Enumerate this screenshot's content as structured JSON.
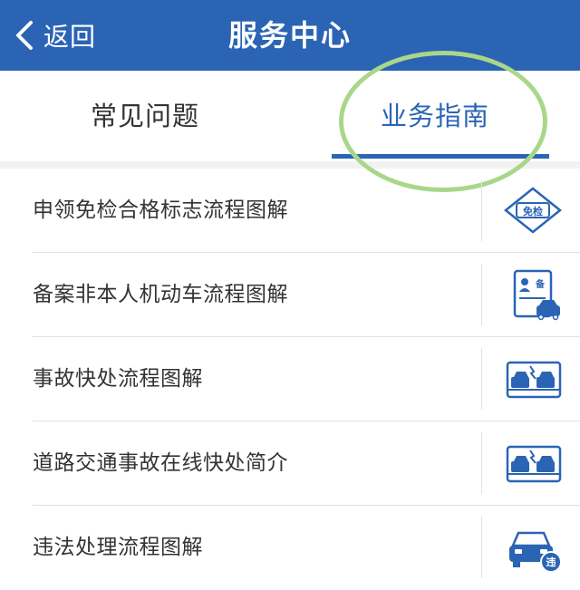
{
  "header": {
    "back_label": "返回",
    "title": "服务中心"
  },
  "tabs": [
    {
      "label": "常见问题",
      "active": false
    },
    {
      "label": "业务指南",
      "active": true
    }
  ],
  "colors": {
    "brand": "#2b64b4",
    "highlight": "#a9d78a"
  },
  "items": [
    {
      "label": "申领免检合格标志流程图解",
      "icon": "exemption-badge-icon",
      "icon_text": "免检"
    },
    {
      "label": "备案非本人机动车流程图解",
      "icon": "vehicle-registration-card-icon",
      "icon_text": "备"
    },
    {
      "label": "事故快处流程图解",
      "icon": "car-collision-icon"
    },
    {
      "label": "道路交通事故在线快处简介",
      "icon": "car-collision-icon"
    },
    {
      "label": "违法处理流程图解",
      "icon": "car-violation-icon",
      "icon_text": "违"
    }
  ]
}
